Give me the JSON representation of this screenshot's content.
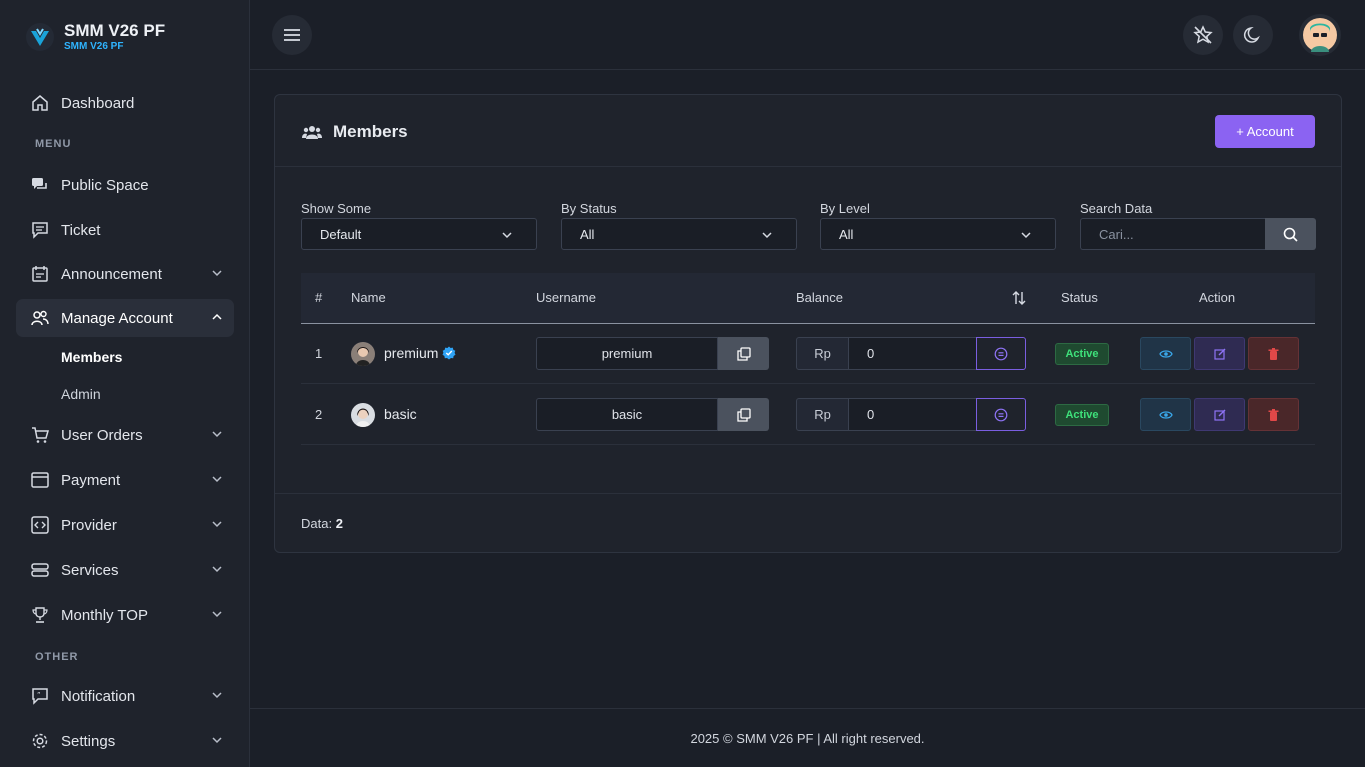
{
  "brand": {
    "title": "SMM V26 PF",
    "subtitle": "SMM V26 PF"
  },
  "sidebar": {
    "dashboard": "Dashboard",
    "menu_label": "MENU",
    "public_space": "Public Space",
    "ticket": "Ticket",
    "announcement": "Announcement",
    "manage_account": "Manage Account",
    "members": "Members",
    "admin": "Admin",
    "user_orders": "User Orders",
    "payment": "Payment",
    "provider": "Provider",
    "services": "Services",
    "monthly_top": "Monthly TOP",
    "other_label": "OTHER",
    "notification": "Notification",
    "settings": "Settings"
  },
  "card": {
    "title": "Members",
    "add_button": "+ Account"
  },
  "filters": {
    "show_some_label": "Show Some",
    "show_some_value": "Default",
    "by_status_label": "By Status",
    "by_status_value": "All",
    "by_level_label": "By Level",
    "by_level_value": "All",
    "search_label": "Search Data",
    "search_placeholder": "Cari..."
  },
  "table": {
    "headers": {
      "num": "#",
      "name": "Name",
      "username": "Username",
      "balance": "Balance",
      "status": "Status",
      "action": "Action"
    },
    "rows": [
      {
        "num": "1",
        "name": "premium",
        "verified": true,
        "username": "premium",
        "currency": "Rp",
        "balance": "0",
        "status": "Active"
      },
      {
        "num": "2",
        "name": "basic",
        "verified": false,
        "username": "basic",
        "currency": "Rp",
        "balance": "0",
        "status": "Active"
      }
    ]
  },
  "footer_card": {
    "label": "Data:",
    "count": "2"
  },
  "footer": {
    "text": "2025 © SMM V26 PF | All right reserved."
  },
  "colors": {
    "accent": "#8b63f2",
    "active_badge": "#3ee07a",
    "brand_sub": "#2fb4ff"
  }
}
